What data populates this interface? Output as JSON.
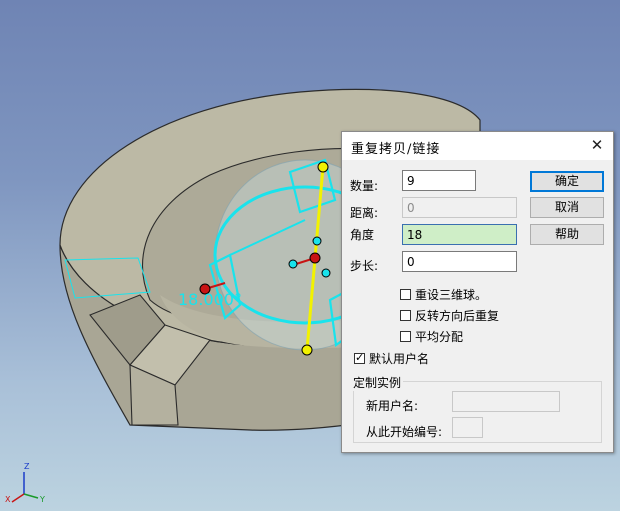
{
  "viewport": {
    "dimension_label": "18.000°",
    "triad": {
      "z": "Z",
      "x": "X",
      "y": "Y"
    }
  },
  "dialog": {
    "title": "重复拷贝/链接",
    "close_glyph": "✕",
    "count_label": "数量:",
    "count_value": "9",
    "distance_label": "距离:",
    "distance_value": "0",
    "angle_label": "角度",
    "angle_value": "18",
    "step_label": "步长:",
    "step_value": "0",
    "ok_label": "确定",
    "cancel_label": "取消",
    "help_label": "帮助",
    "reset_triad_label": "重设三维球。",
    "reverse_label": "反转方向后重复",
    "distribute_label": "平均分配",
    "default_name_label": "默认用户名",
    "reset_triad_checked": false,
    "reverse_checked": false,
    "distribute_checked": false,
    "default_name_checked": true,
    "custom_instance_title": "定制实例",
    "new_name_label": "新用户名:",
    "new_name_value": "",
    "start_number_label": "从此开始编号:",
    "start_number_value": ""
  },
  "colors": {
    "model_top": "#bdbaa6",
    "model_side": "#a8a594",
    "preview_cyan": "#19e3ec",
    "axis_yellow": "#f2f200",
    "handle_red": "#c81414"
  }
}
